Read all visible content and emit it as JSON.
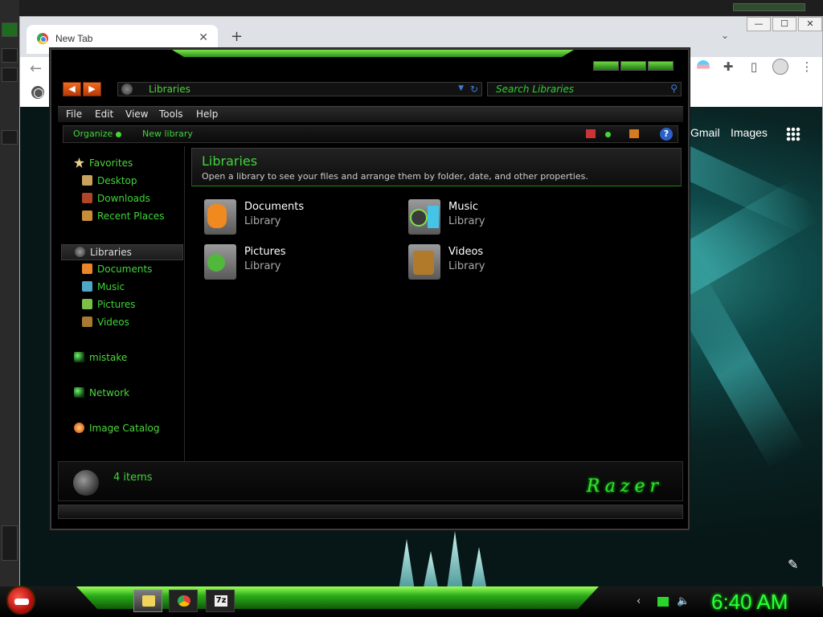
{
  "chrome": {
    "tab_title": "New Tab",
    "tab_close": "✕",
    "new_tab": "+",
    "tab_dropdown": "⌄",
    "back": "←",
    "win_min": "—",
    "win_max": "☐",
    "win_close": "✕",
    "gmail": "Gmail",
    "images": "Images",
    "edit": "✎",
    "actions": [
      "puzzle-icon",
      "side-panel-icon",
      "profile-icon",
      "menu-icon"
    ]
  },
  "explorer": {
    "address": "Libraries",
    "search_placeholder": "Search Libraries",
    "menu": [
      "File",
      "Edit",
      "View",
      "Tools",
      "Help"
    ],
    "commands": {
      "organize": "Organize",
      "new_library": "New library",
      "help": "?"
    },
    "nav": {
      "favorites": "Favorites",
      "favorite_items": [
        "Desktop",
        "Downloads",
        "Recent Places"
      ],
      "libraries": "Libraries",
      "library_items": [
        "Documents",
        "Music",
        "Pictures",
        "Videos"
      ],
      "homegroup": "mistake",
      "network": "Network",
      "catalog": "Image Catalog"
    },
    "header": {
      "title": "Libraries",
      "subtitle": "Open a library to see your files and arrange them by folder, date, and other properties."
    },
    "libraries": [
      {
        "name": "Documents",
        "type": "Library",
        "color": "#f08a20"
      },
      {
        "name": "Music",
        "type": "Library",
        "color": "#45c3e8"
      },
      {
        "name": "Pictures",
        "type": "Library",
        "color": "#52b83c"
      },
      {
        "name": "Videos",
        "type": "Library",
        "color": "#b07a2a"
      }
    ],
    "status_count": "4 items",
    "brand": "Razer"
  },
  "taskbar": {
    "clock": "6:40 AM",
    "items": [
      "explorer",
      "chrome",
      "7zip"
    ],
    "zip_label": "7z"
  },
  "colors": {
    "accent": "#3fd53a",
    "clock": "#2aff36"
  }
}
